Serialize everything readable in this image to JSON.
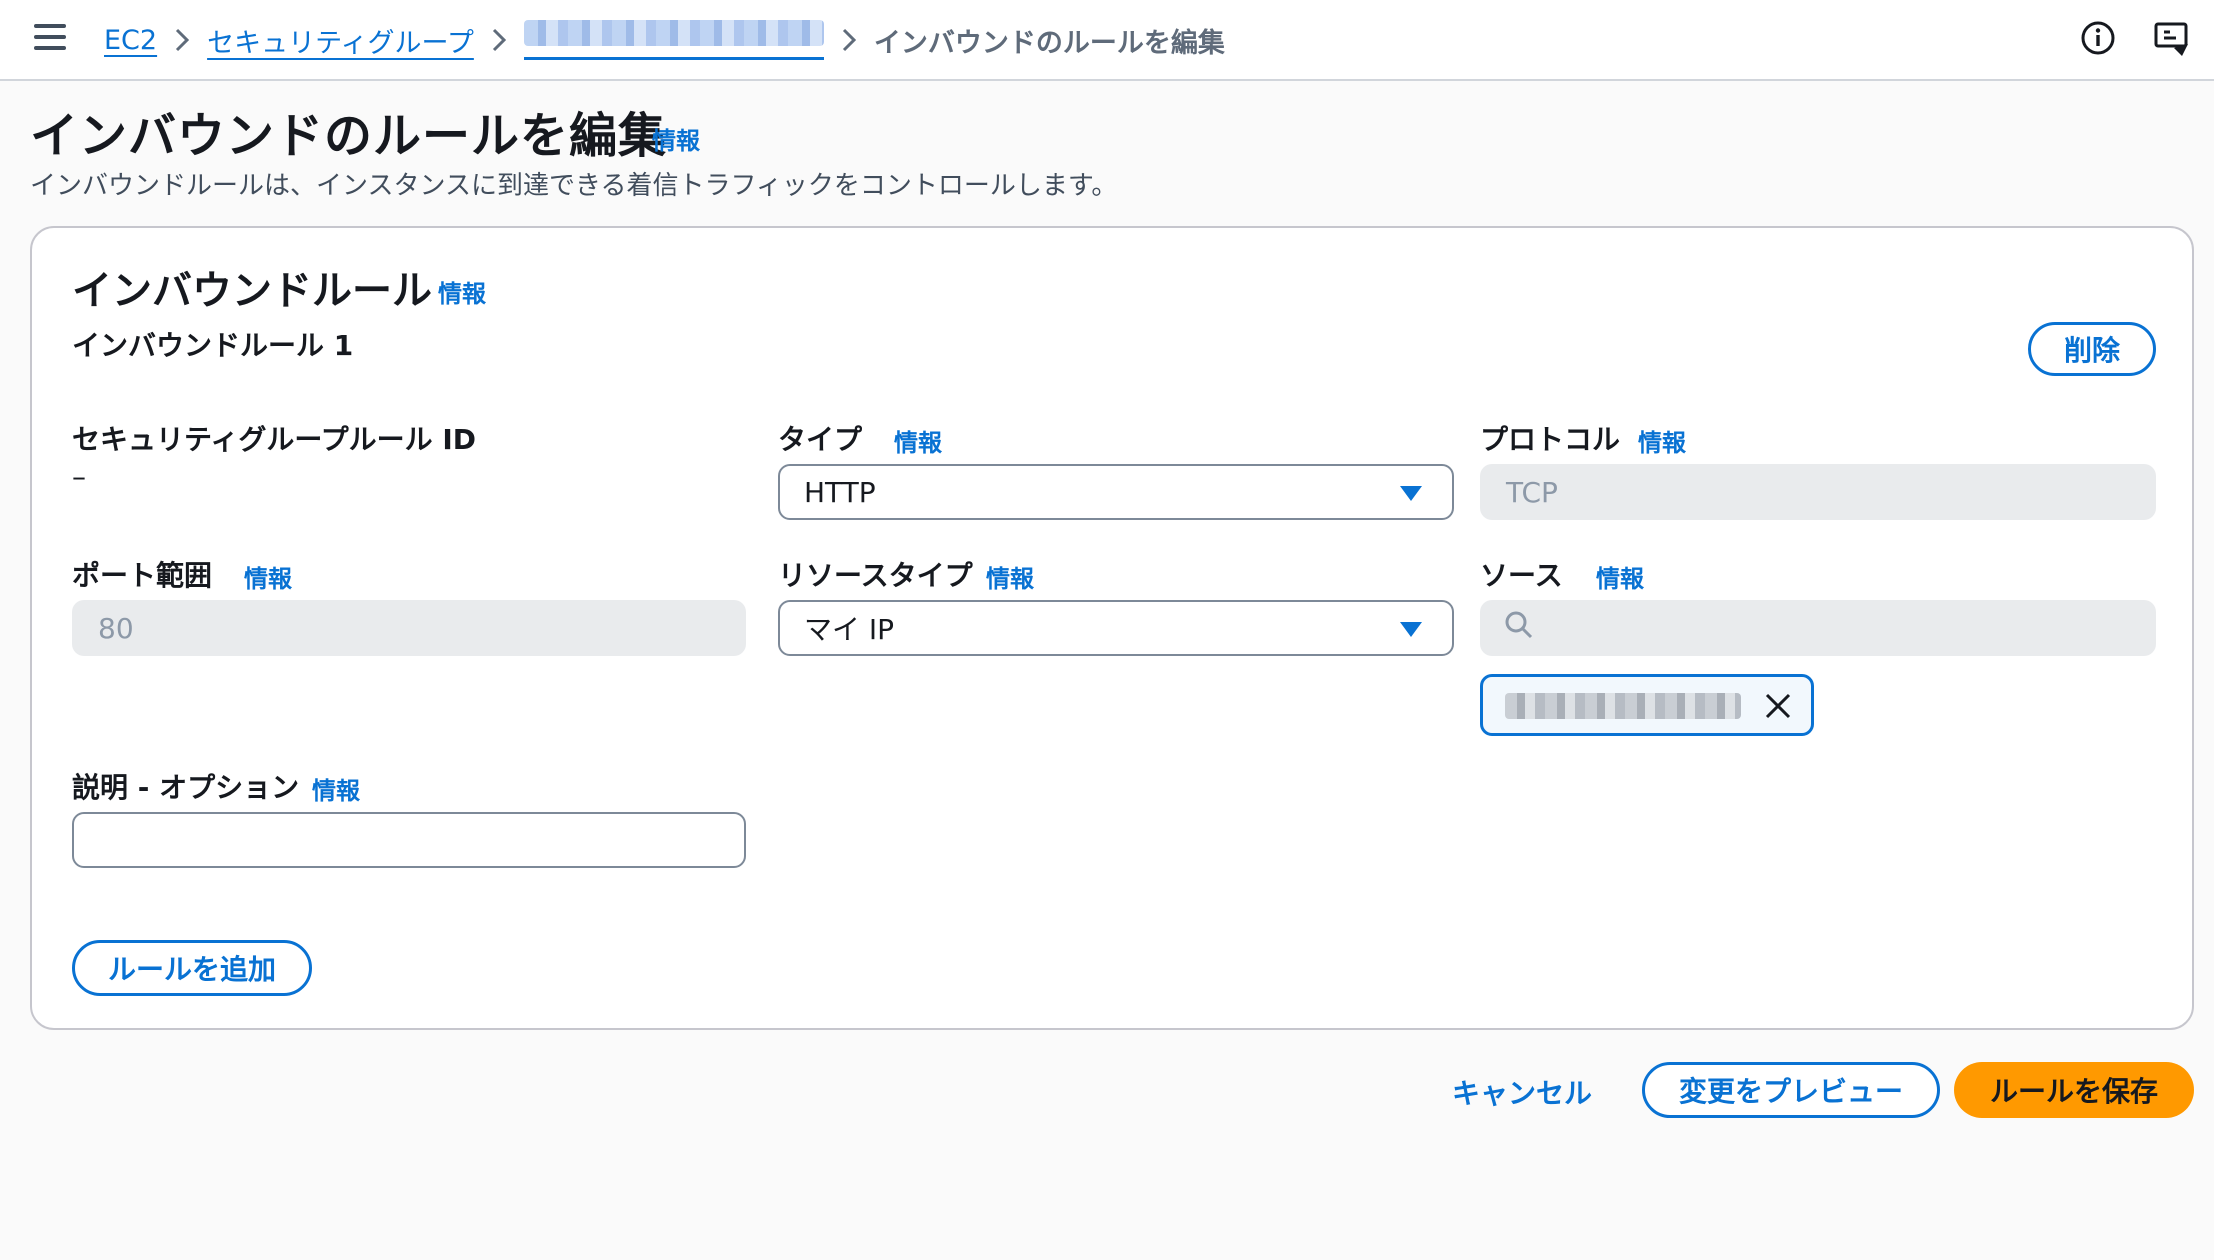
{
  "breadcrumb": {
    "ec2": "EC2",
    "security_groups": "セキュリティグループ",
    "current": "インバウンドのルールを編集"
  },
  "page": {
    "title": "インバウンドのルールを編集",
    "info": "情報",
    "description": "インバウンドルールは、インスタンスに到達できる着信トラフィックをコントロールします。"
  },
  "panel": {
    "title": "インバウンドルール",
    "info": "情報",
    "rule_heading": "インバウンドルール 1",
    "delete_label": "削除",
    "add_rule_label": "ルールを追加"
  },
  "fields": {
    "sg_rule_id": {
      "label": "セキュリティグループルール ID",
      "value": "–"
    },
    "type": {
      "label": "タイプ",
      "info": "情報",
      "value": "HTTP"
    },
    "protocol": {
      "label": "プロトコル",
      "info": "情報",
      "value": "TCP"
    },
    "port_range": {
      "label": "ポート範囲",
      "info": "情報",
      "value": "80"
    },
    "resource_type": {
      "label": "リソースタイプ",
      "info": "情報",
      "value": "マイ IP"
    },
    "source": {
      "label": "ソース",
      "info": "情報",
      "placeholder": ""
    },
    "description": {
      "label": "説明 - オプション",
      "info": "情報",
      "value": ""
    }
  },
  "footer": {
    "cancel_label": "キャンセル",
    "preview_label": "変更をプレビュー",
    "save_label": "ルールを保存"
  },
  "colors": {
    "link": "#0972d3",
    "primary": "#ff9900",
    "disabled_bg": "#e9ebed"
  },
  "icons": [
    "menu-icon",
    "chevron-right-icon",
    "info-circle-icon",
    "feedback-icon",
    "caret-down-icon",
    "search-icon",
    "close-icon"
  ]
}
